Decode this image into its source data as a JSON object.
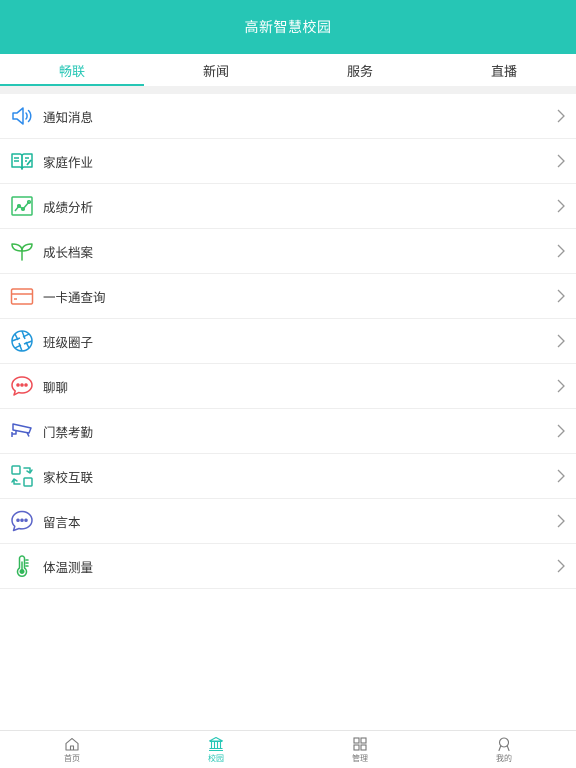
{
  "header": {
    "title": "高新智慧校园"
  },
  "tabs": [
    {
      "label": "畅联",
      "active": true
    },
    {
      "label": "新闻",
      "active": false
    },
    {
      "label": "服务",
      "active": false
    },
    {
      "label": "直播",
      "active": false
    }
  ],
  "menu": [
    {
      "label": "通知消息",
      "icon": "speaker-icon",
      "color": "#2E8BEB"
    },
    {
      "label": "家庭作业",
      "icon": "book-edit-icon",
      "color": "#1BB59A"
    },
    {
      "label": "成绩分析",
      "icon": "chart-analysis-icon",
      "color": "#3CC26B"
    },
    {
      "label": "成长档案",
      "icon": "sprout-icon",
      "color": "#3DBA4E"
    },
    {
      "label": "一卡通查询",
      "icon": "card-icon",
      "color": "#F07A5A"
    },
    {
      "label": "班级圈子",
      "icon": "aperture-icon",
      "color": "#2196D9"
    },
    {
      "label": "聊聊",
      "icon": "chat-bubble-icon",
      "color": "#EE4D55"
    },
    {
      "label": "门禁考勤",
      "icon": "camera-icon",
      "color": "#4A5FC9"
    },
    {
      "label": "家校互联",
      "icon": "connect-icon",
      "color": "#2BB59E"
    },
    {
      "label": "留言本",
      "icon": "message-icon",
      "color": "#5A64C8"
    },
    {
      "label": "体温测量",
      "icon": "thermometer-icon",
      "color": "#33B75A"
    }
  ],
  "bottom_nav": [
    {
      "label": "首页",
      "icon": "home-icon",
      "active": false
    },
    {
      "label": "校园",
      "icon": "campus-icon",
      "active": true
    },
    {
      "label": "管理",
      "icon": "grid-icon",
      "active": false
    },
    {
      "label": "我的",
      "icon": "user-icon",
      "active": false
    }
  ],
  "colors": {
    "primary": "#26C6B5"
  }
}
